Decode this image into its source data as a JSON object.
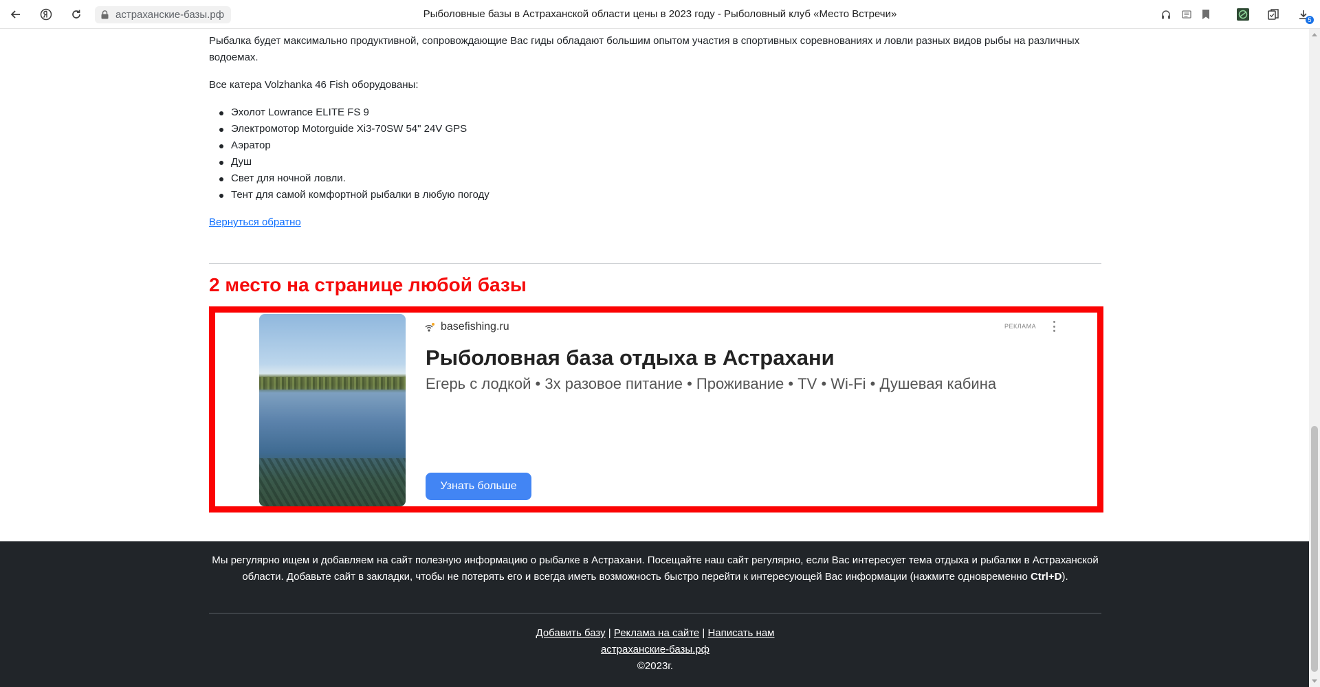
{
  "browser": {
    "address": "астраханские-базы.рф",
    "tab_title": "Рыболовные базы в Астраханской области цены в 2023 году - Рыболовный клуб «Место Встречи»",
    "downloads_badge": "5"
  },
  "article": {
    "intro": "Рыбалка будет максимально продуктивной, сопровождающие Вас гиды обладают большим опытом участия в спортивных соревнованиях и ловли разных видов рыбы на различных водоемах.",
    "equipment_heading": "Все катера Volzhanka 46 Fish оборудованы:",
    "equipment": [
      "Эхолот Lowrance ELITE FS 9",
      "Электромотор Motorguide Xi3-70SW 54\" 24V GPS",
      "Аэратор",
      "Душ",
      "Свет для ночной ловли.",
      "Тент для самой комфортной рыбалки в любую погоду"
    ],
    "back_link": "Вернуться обратно"
  },
  "promo": {
    "title": "2 место на странице любой базы"
  },
  "ad": {
    "domain": "basefishing.ru",
    "label": "РЕКЛАМА",
    "title": "Рыболовная база отдыха в Астрахани",
    "description": "Егерь с лодкой • 3х разовое питание • Проживание • TV • Wi-Fi • Душевая кабина",
    "button": "Узнать больше",
    "border_color": "#fb0303",
    "button_color": "#4285f4"
  },
  "footer": {
    "text_part1": "Мы регулярно ищем и добавляем на сайт полезную информацию о рыбалке в Астрахани. Посещайте наш сайт регулярно, если Вас интересует тема отдыха и рыбалки в Астраханской области. Добавьте сайт в закладки, чтобы не потерять его и всегда иметь возможность быстро перейти к интересующей Вас информации (нажмите одновременно ",
    "shortcut": "Ctrl+D",
    "text_part2": ").",
    "links": [
      "Добавить базу",
      "Реклама на сайте",
      "Написать нам"
    ],
    "separator": "|",
    "site": "астраханские-базы.рф",
    "copyright": "©2023г.",
    "background": "#212529"
  },
  "colors": {
    "promo_title": "#f50c0c",
    "link": "#0d6efd"
  }
}
